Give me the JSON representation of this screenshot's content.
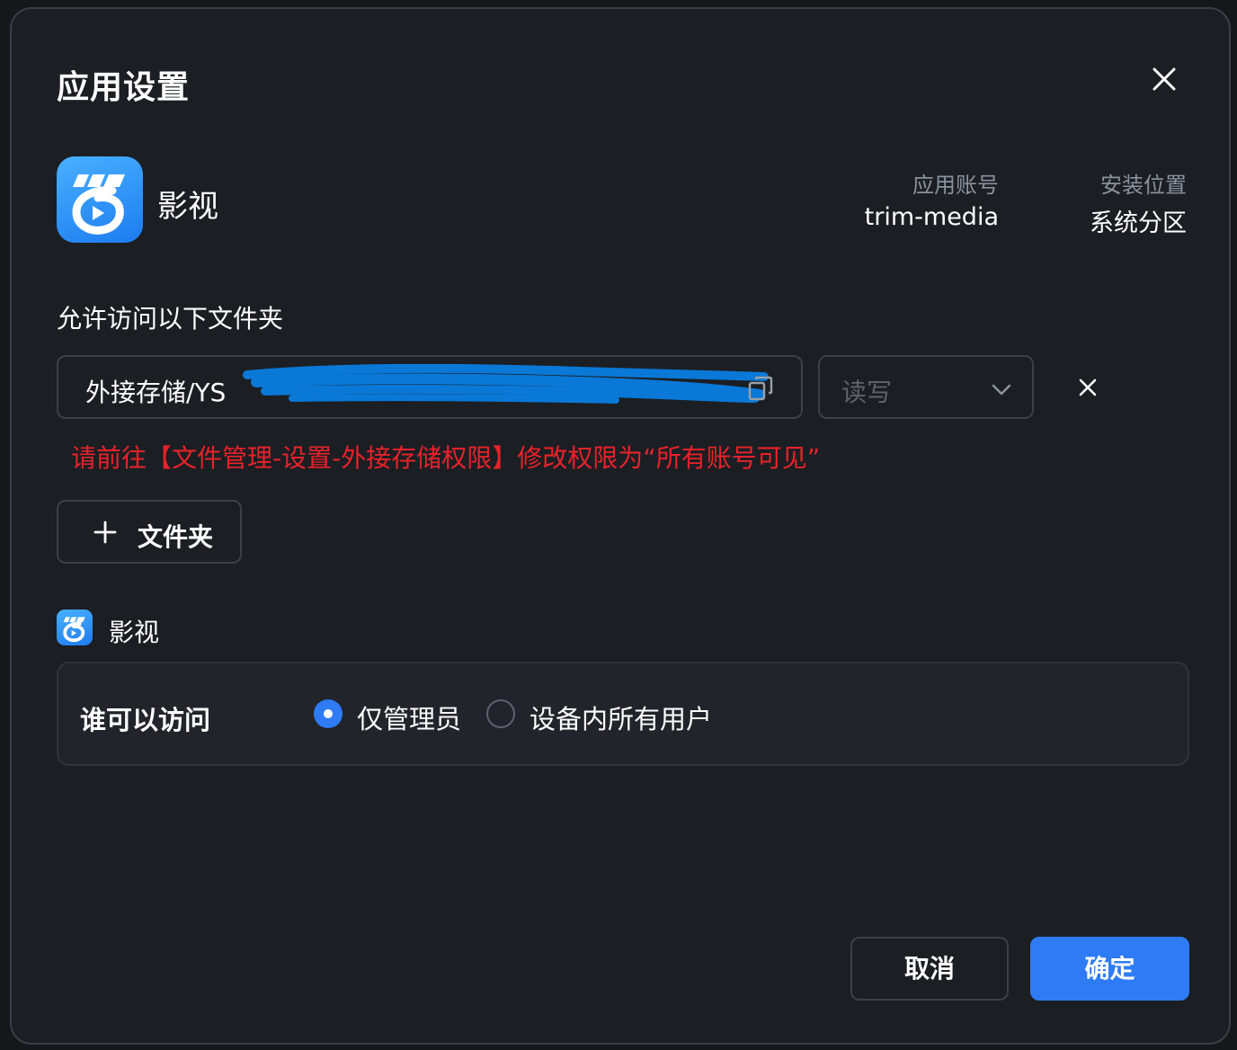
{
  "dialog": {
    "title": "应用设置"
  },
  "app": {
    "name": "影视",
    "account_label": "应用账号",
    "account_value": "trim-media",
    "location_label": "安装位置",
    "location_value": "系统分区"
  },
  "folders": {
    "section_label": "允许访问以下文件夹",
    "items": [
      {
        "path": "外接存储/YS",
        "permission": "读写"
      }
    ],
    "warning": "请前往【文件管理-设置-外接存储权限】修改权限为“所有账号可见”",
    "add_label": "文件夹"
  },
  "access": {
    "app_name": "影视",
    "label": "谁可以访问",
    "options": [
      {
        "label": "仅管理员",
        "selected": true
      },
      {
        "label": "设备内所有用户",
        "selected": false
      }
    ]
  },
  "footer": {
    "cancel_label": "取消",
    "confirm_label": "确定"
  },
  "colors": {
    "accent": "#2f7bf5",
    "warning": "#e8222a",
    "background": "#1b1e23",
    "redaction": "#0a78d6"
  },
  "icons": {
    "close": "close-icon",
    "copy": "copy-icon",
    "chevron": "chevron-down-icon",
    "remove": "remove-icon",
    "add": "plus-icon",
    "app": "film-play-icon"
  }
}
